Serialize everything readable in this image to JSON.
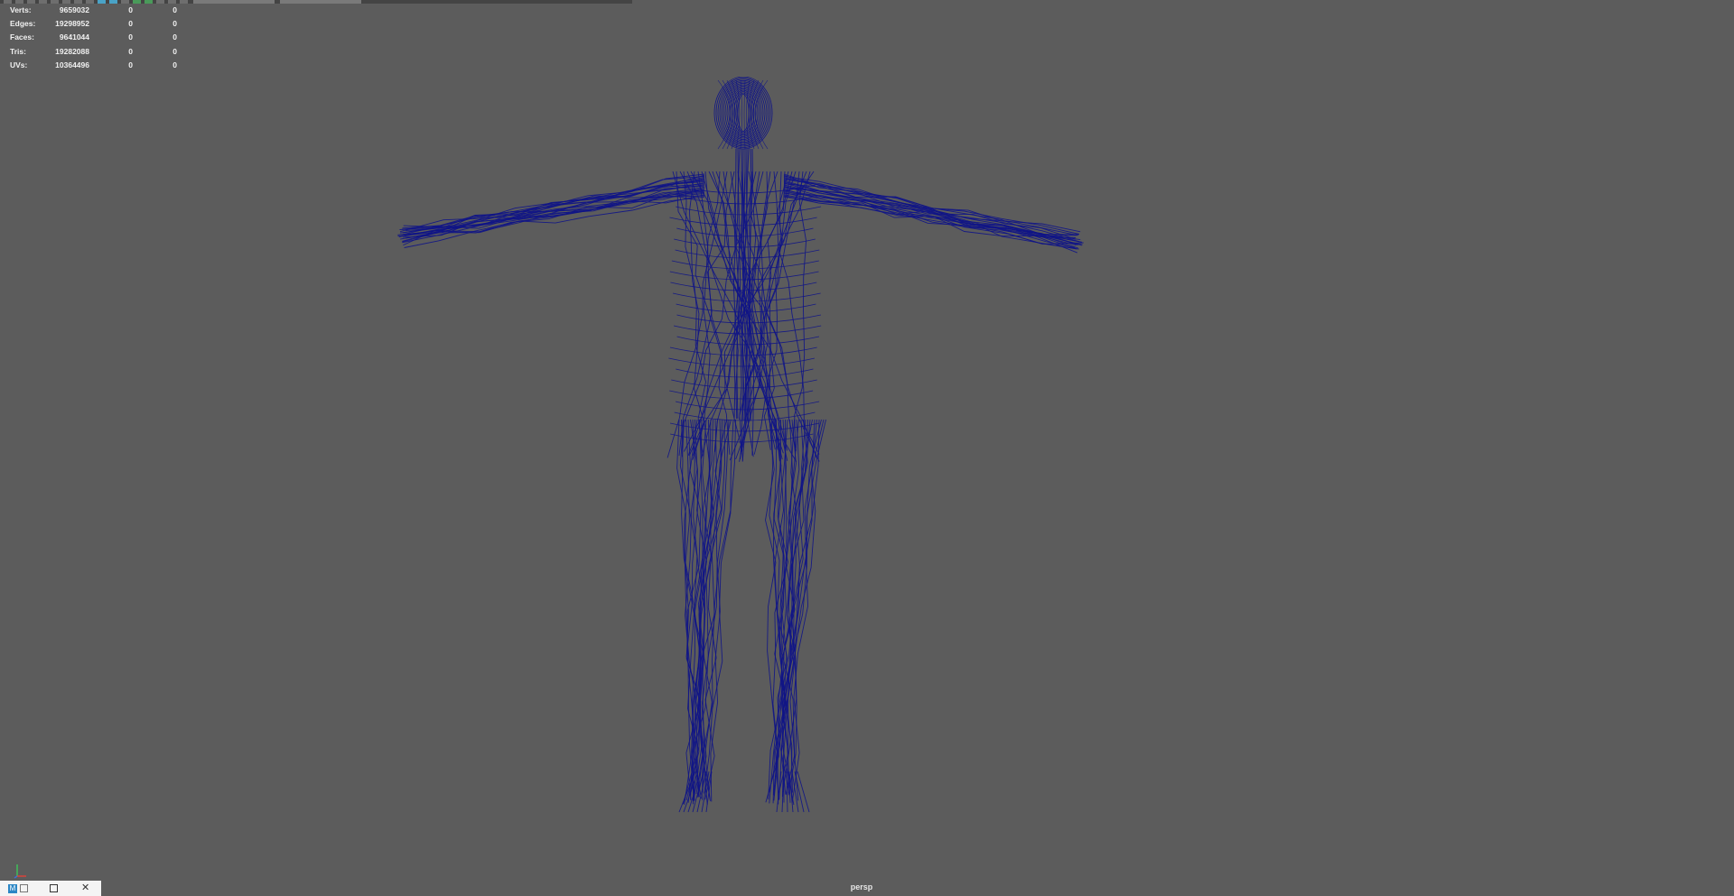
{
  "viewport": {
    "camera": "persp",
    "background_color": "#5c5c5c",
    "wireframe_color": "#0f1487"
  },
  "hud": {
    "rows": [
      {
        "label": "Verts:",
        "total": "9659032",
        "selected": "0",
        "component": "0"
      },
      {
        "label": "Edges:",
        "total": "19298952",
        "selected": "0",
        "component": "0"
      },
      {
        "label": "Faces:",
        "total": "9641044",
        "selected": "0",
        "component": "0"
      },
      {
        "label": "Tris:",
        "total": "19282088",
        "selected": "0",
        "component": "0"
      },
      {
        "label": "UVs:",
        "total": "10364496",
        "selected": "0",
        "component": "0"
      }
    ]
  },
  "icons": {
    "axis": "axis-gizmo-icon",
    "app": "maya-app-icon",
    "restore": "restore-icon",
    "maximize": "maximize-icon",
    "close": "close-icon"
  }
}
